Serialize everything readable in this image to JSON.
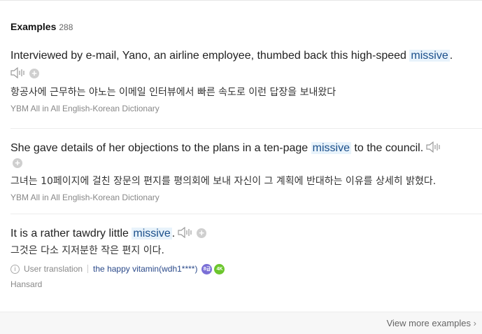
{
  "header": {
    "title": "Examples",
    "count": "288"
  },
  "examples": [
    {
      "pre": "Interviewed by e-mail, Yano, an airline employee, thumbed back this high-speed ",
      "keyword": "missive",
      "post": ".",
      "translation": "항공사에 근무하는 야노는 이메일 인터뷰에서 빠른 속도로 이런 답장을 보내왔다",
      "source": "YBM All in All English-Korean Dictionary"
    },
    {
      "pre": "She gave details of her objections to the plans in a ten-page ",
      "keyword": "missive",
      "post": " to the council.",
      "translation": "그녀는 10페이지에 걸친 장문의 편지를 평의회에 보내 자신이 그 계획에 반대하는 이유를 상세히 밝혔다.",
      "source": "YBM All in All English-Korean Dictionary"
    },
    {
      "pre": "It is a rather tawdry little ",
      "keyword": "missive",
      "post": ".",
      "translation": "그것은 다소 지저분한 작은 편지 이다.",
      "user_translation_label": "User translation",
      "user": "the happy vitamin(wdh1****)",
      "badge1": "8급",
      "badge2": "4K",
      "source": "Hansard"
    }
  ],
  "footer": {
    "view_more": "View more examples"
  },
  "icons": {
    "speaker": "speaker-icon",
    "plus": "add-icon",
    "info": "info-icon",
    "chevron": "chevron-right-icon"
  }
}
